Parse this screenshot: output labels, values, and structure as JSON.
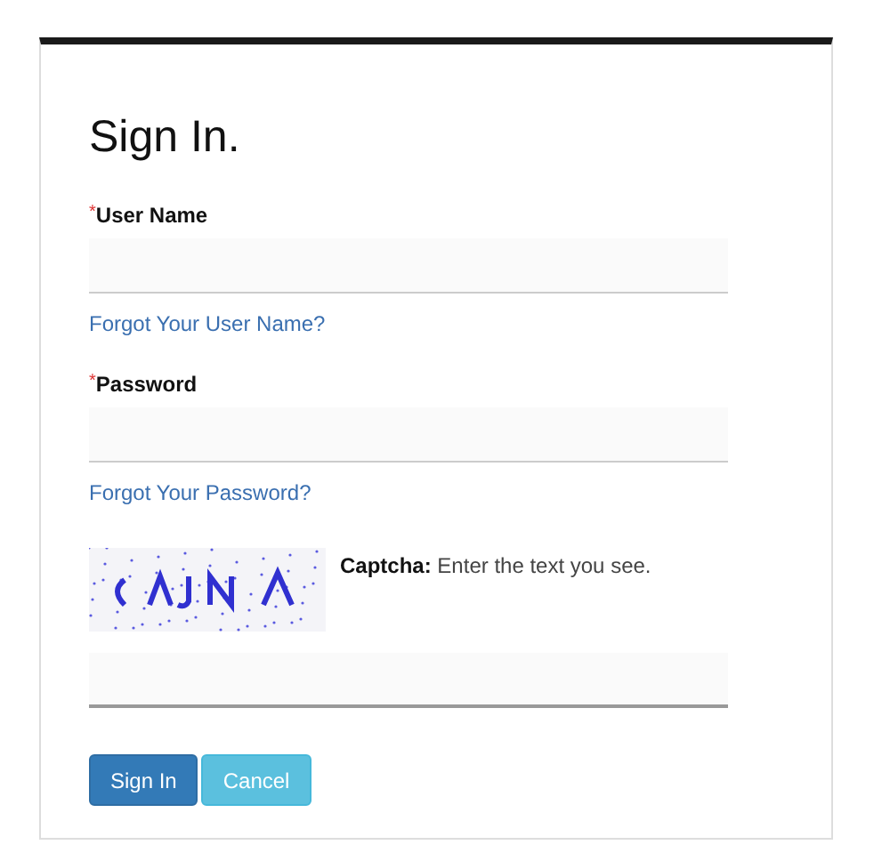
{
  "title": "Sign In.",
  "fields": [
    {
      "label": "User Name",
      "required_mark": "*",
      "focused": false,
      "link": "Forgot Your User Name?"
    },
    {
      "label": "Password",
      "required_mark": "*",
      "focused": false,
      "link": "Forgot Your Password?"
    }
  ],
  "captcha": {
    "instruction": "**Captcha:** Enter the text you see.",
    "focused": true
  },
  "buttons": [
    {
      "label": "Sign In",
      "kind": "primary"
    },
    {
      "label": "Cancel",
      "kind": "info"
    }
  ]
}
